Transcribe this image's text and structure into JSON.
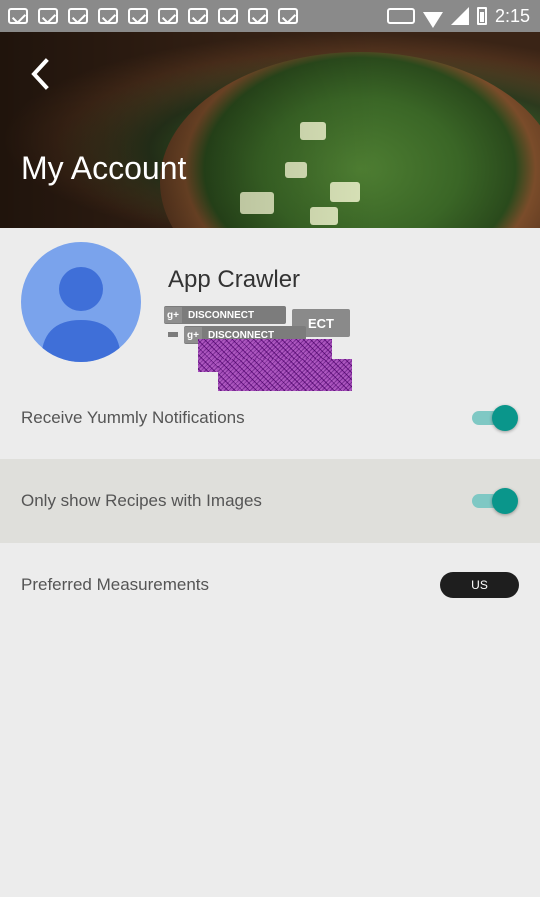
{
  "status_bar": {
    "time": "2:15",
    "notification_icons": [
      "gmail-icon",
      "flipboard-icon",
      "flipboard-icon",
      "flipboard-icon",
      "flipboard-icon",
      "flipboard-icon",
      "flipboard-icon",
      "flipboard-icon",
      "flipboard-icon",
      "flipboard-icon"
    ],
    "system_icons": [
      "keyboard-icon",
      "wifi-icon",
      "signal-icon",
      "battery-icon"
    ]
  },
  "header": {
    "title": "My Account",
    "back_icon": "chevron-left-icon",
    "image": "salad-bowl-photo"
  },
  "profile": {
    "name": "App Crawler",
    "avatar_icon": "person-placeholder-icon",
    "buttons": [
      {
        "icon": "google-plus-icon",
        "icon_text": "g+",
        "label": "DISCONNECT"
      },
      {
        "icon": "google-plus-icon",
        "icon_text": "g+",
        "label": "DISCONNECT"
      }
    ],
    "partial_button_label": "ECT"
  },
  "settings": [
    {
      "label": "Receive Yummly Notifications",
      "control": "toggle",
      "checked": true
    },
    {
      "label": "Only show Recipes with Images",
      "control": "toggle",
      "checked": true
    },
    {
      "label": "Preferred Measurements",
      "control": "selector",
      "value": "US"
    }
  ],
  "colors": {
    "toggle_thumb": "#0a968b",
    "toggle_track": "#7fc8c4",
    "avatar_bg": "#7aa3ec",
    "highlight_row": "#dfdfdb"
  }
}
